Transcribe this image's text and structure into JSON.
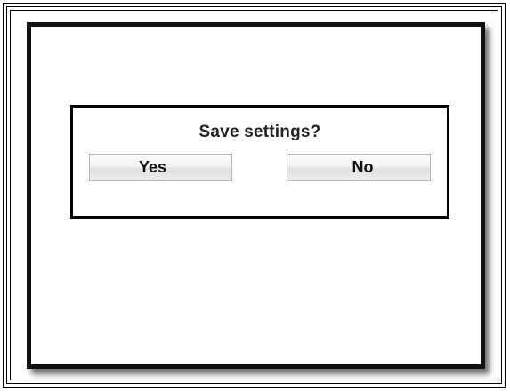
{
  "dialog": {
    "title": "Save settings?",
    "yes_label": "Yes",
    "no_label": "No"
  }
}
